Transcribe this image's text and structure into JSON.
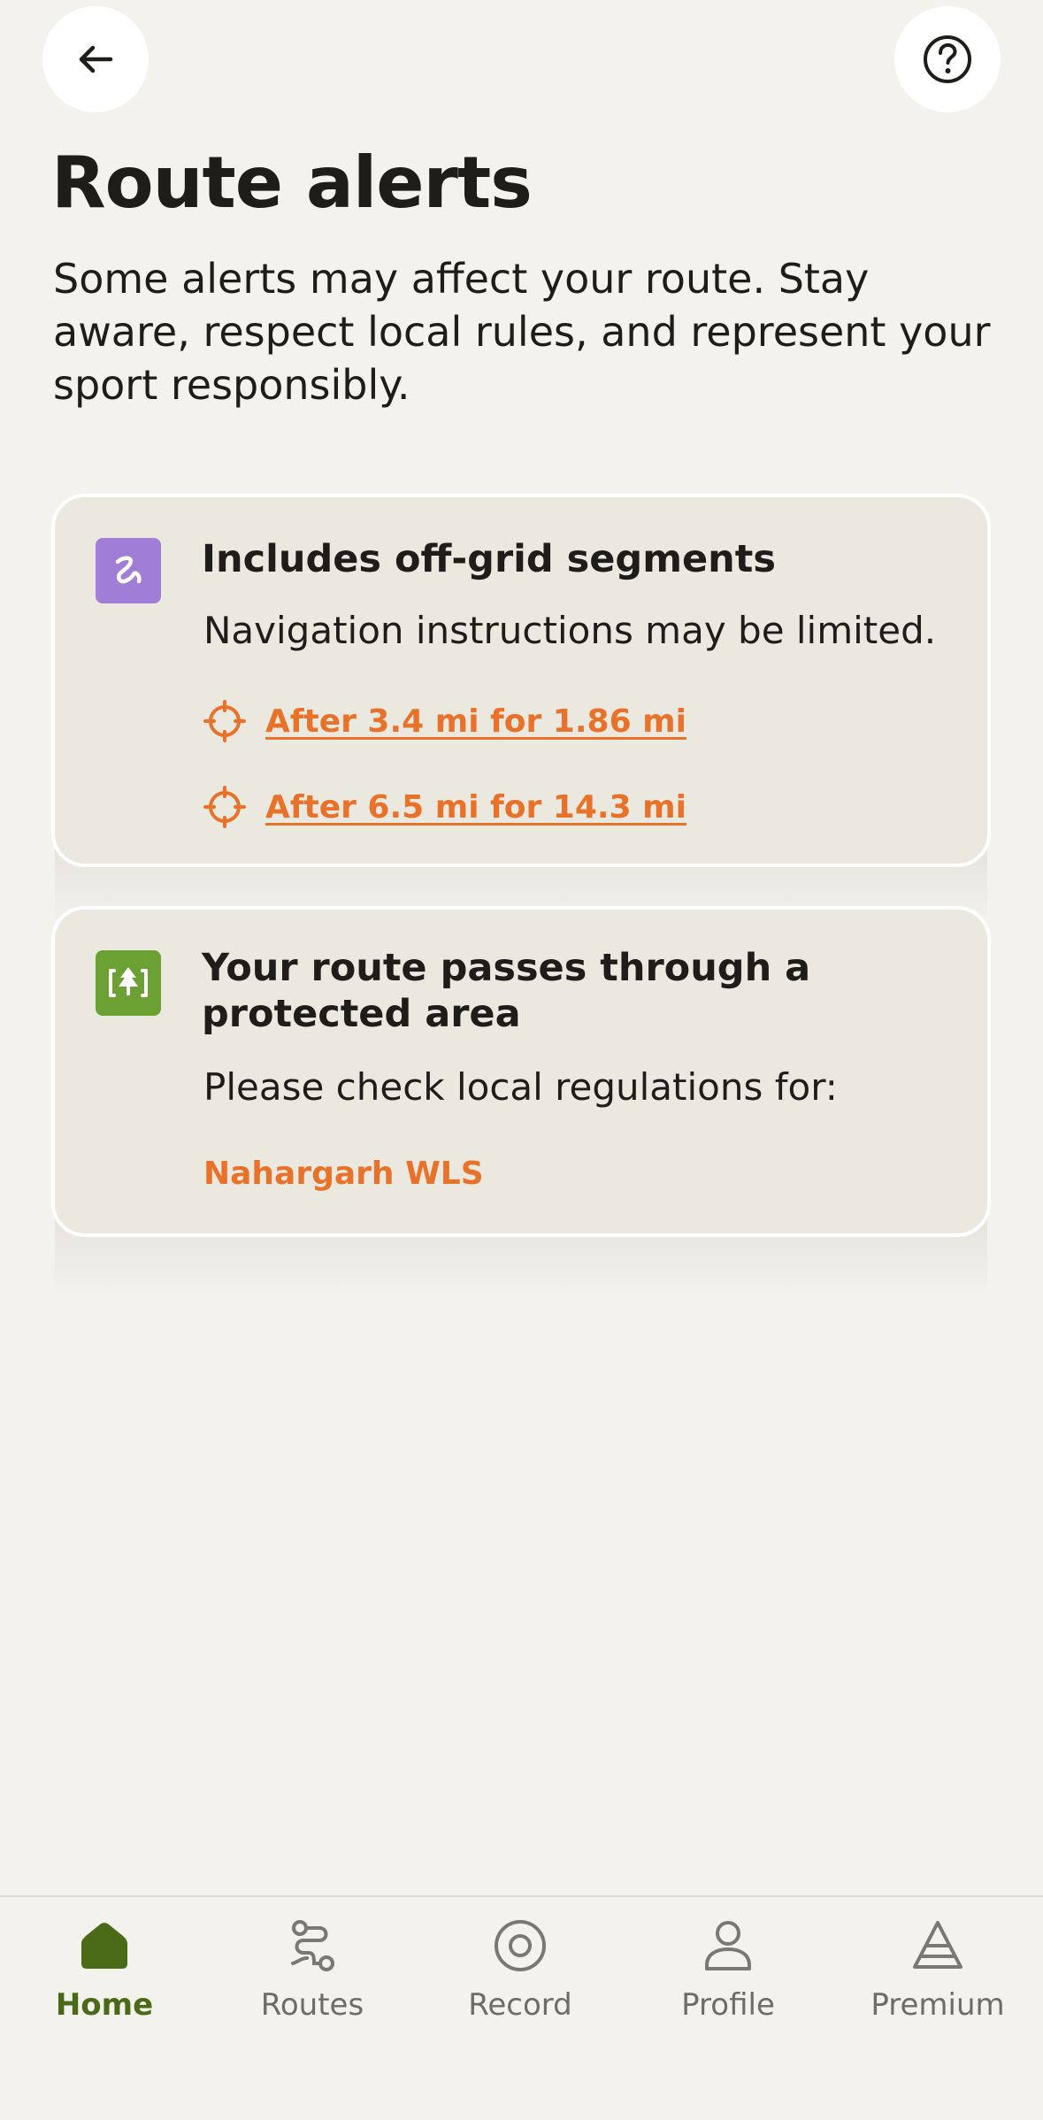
{
  "header": {
    "back_icon": "arrow-left-icon",
    "help_icon": "question-circle-icon"
  },
  "page": {
    "title": "Route alerts",
    "subtitle": "Some alerts may affect your route. Stay aware, respect local rules, and represent your sport responsibly."
  },
  "alerts": [
    {
      "icon": "squiggle-route-icon",
      "icon_color": "#a07ed8",
      "title": "Includes off-grid segments",
      "text": "Navigation instructions may be limited.",
      "segments": [
        {
          "icon": "crosshair-icon",
          "label": "After 3.4 mi for 1.86 mi"
        },
        {
          "icon": "crosshair-icon",
          "label": "After 6.5 mi for 14.3 mi"
        }
      ]
    },
    {
      "icon": "tree-area-icon",
      "icon_color": "#6aa132",
      "title": "Your route passes through a protected area",
      "text": "Please check local regulations for:",
      "areas": [
        "Nahargarh WLS"
      ]
    }
  ],
  "nav": {
    "items": [
      {
        "label": "Home",
        "icon": "home-icon",
        "active": true
      },
      {
        "label": "Routes",
        "icon": "routes-icon",
        "active": false
      },
      {
        "label": "Record",
        "icon": "record-icon",
        "active": false
      },
      {
        "label": "Profile",
        "icon": "profile-icon",
        "active": false
      },
      {
        "label": "Premium",
        "icon": "premium-icon",
        "active": false
      }
    ]
  },
  "colors": {
    "accent_orange": "#e8722a",
    "active_green": "#4b6a17",
    "background": "#f3f2ec",
    "card_bg": "#ebe8e0"
  }
}
